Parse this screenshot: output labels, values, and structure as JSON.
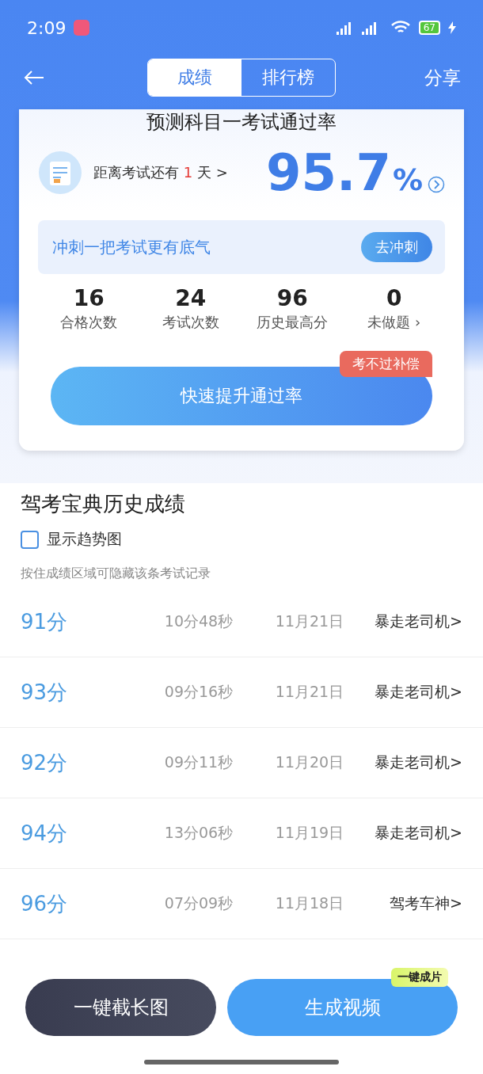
{
  "status_bar": {
    "time": "2:09",
    "battery": "67"
  },
  "nav": {
    "tabs": [
      {
        "label": "成绩",
        "selected": true
      },
      {
        "label": "排行榜",
        "selected": false
      }
    ],
    "share": "分享"
  },
  "card": {
    "title": "预测科目一考试通过率",
    "countdown": {
      "prefix": "距离考试还有",
      "days": "1",
      "suffix": "天",
      "arrow": ">"
    },
    "rate": {
      "value": "95.7",
      "unit": "%"
    },
    "sprint": {
      "text": "冲刺一把考试更有底气",
      "button": "去冲刺"
    },
    "stats": [
      {
        "value": "16",
        "label": "合格次数"
      },
      {
        "value": "24",
        "label": "考试次数"
      },
      {
        "value": "96",
        "label": "历史最高分"
      },
      {
        "value": "0",
        "label": "未做题",
        "arrow": "›"
      }
    ],
    "cta": {
      "label": "快速提升通过率",
      "badge": "考不过补偿"
    }
  },
  "history": {
    "title": "驾考宝典历史成绩",
    "trend": {
      "label": "显示趋势图",
      "checked": false
    },
    "hint": "按住成绩区域可隐藏该条考试记录",
    "rows": [
      {
        "score": "91分",
        "duration": "10分48秒",
        "date": "11月21日",
        "title": "暴走老司机>"
      },
      {
        "score": "93分",
        "duration": "09分16秒",
        "date": "11月21日",
        "title": "暴走老司机>"
      },
      {
        "score": "92分",
        "duration": "09分11秒",
        "date": "11月20日",
        "title": "暴走老司机>"
      },
      {
        "score": "94分",
        "duration": "13分06秒",
        "date": "11月19日",
        "title": "暴走老司机>"
      },
      {
        "score": "96分",
        "duration": "07分09秒",
        "date": "11月18日",
        "title": "驾考车神>"
      }
    ]
  },
  "bottom": {
    "screenshot": "一键截长图",
    "video": "生成视频",
    "video_badge": "一键成片"
  }
}
